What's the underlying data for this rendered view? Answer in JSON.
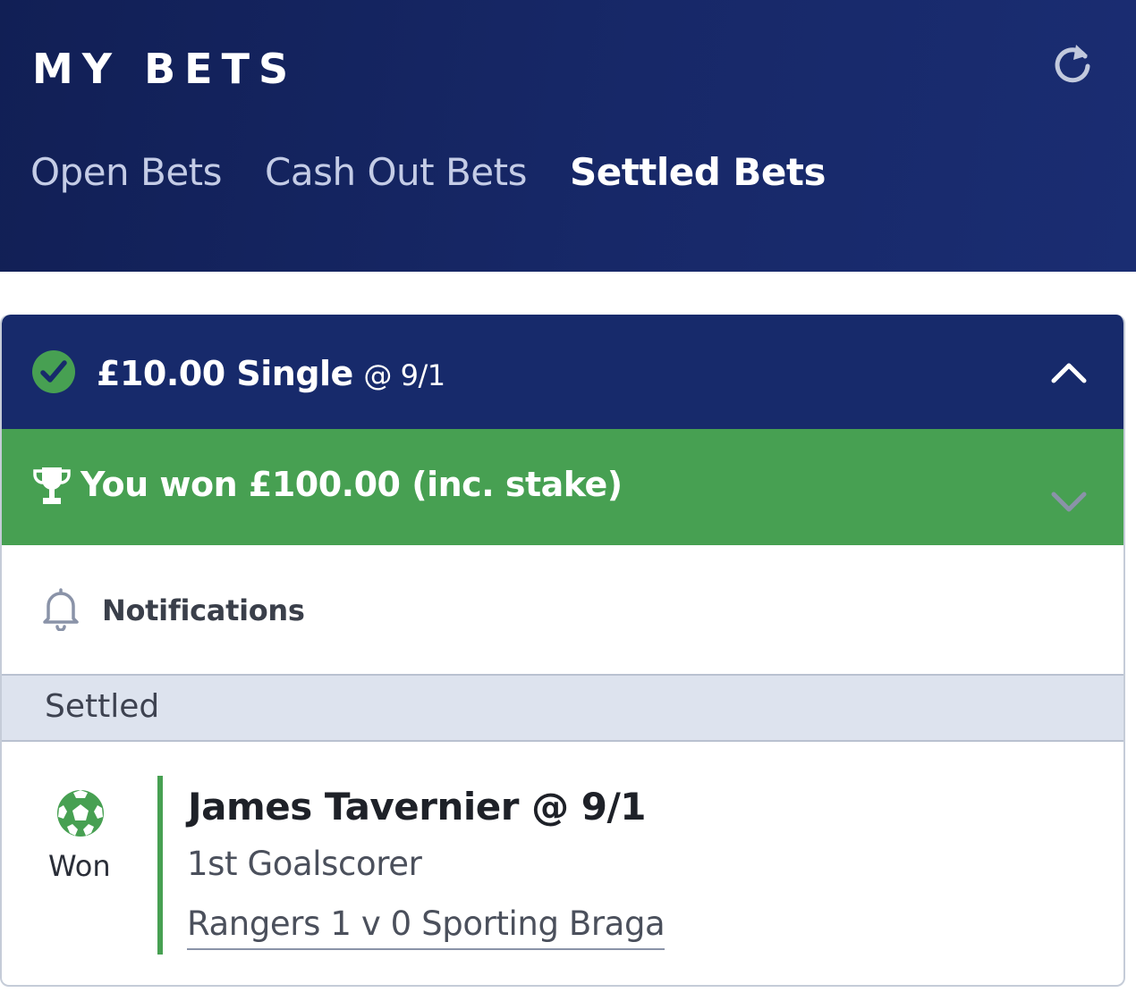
{
  "header": {
    "title": "MY BETS",
    "tabs": [
      {
        "label": "Open Bets",
        "active": false
      },
      {
        "label": "Cash Out Bets",
        "active": false
      },
      {
        "label": "Settled Bets",
        "active": true
      }
    ],
    "refresh_icon": "refresh-icon"
  },
  "bet": {
    "stake_type": "£10.00 Single",
    "odds": "@ 9/1",
    "status_icon": "check-circle-icon",
    "won_message": "You won £100.00 (inc. stake)",
    "won_icon": "trophy-icon",
    "notifications_label": "Notifications",
    "section_label": "Settled",
    "selection": {
      "name": "James Tavernier @ 9/1",
      "market": "1st Goalscorer",
      "event": "Rangers 1 v 0 Sporting Braga",
      "result": "Won",
      "sport_icon": "football-icon"
    }
  },
  "colors": {
    "header_bg": "#14245f",
    "bet_header_bg": "#172a6b",
    "won_green": "#47a052",
    "settled_bar_bg": "#dde3ee"
  }
}
